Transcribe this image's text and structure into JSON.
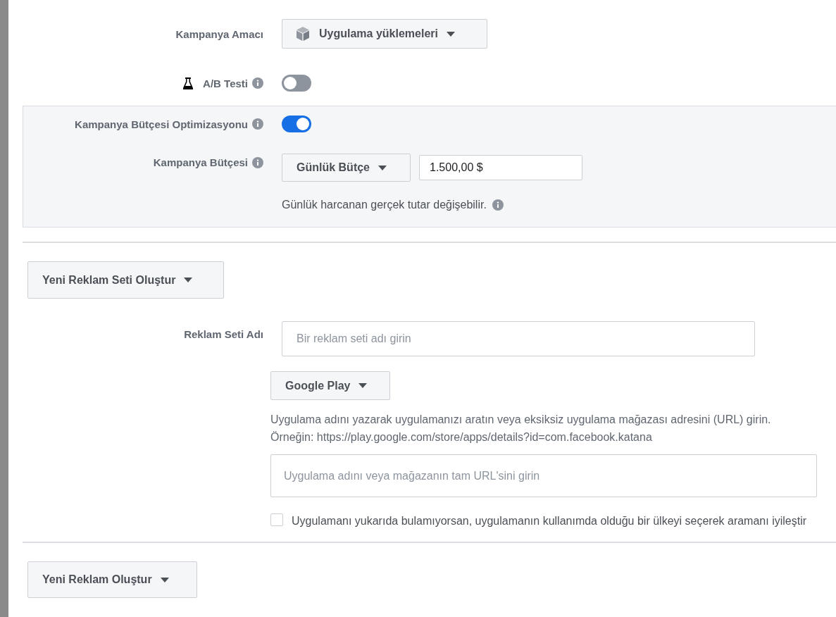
{
  "objective": {
    "label": "Kampanya Amacı",
    "value": "Uygulama yüklemeleri"
  },
  "ab_test": {
    "label": "A/B Testi",
    "on": false
  },
  "budget_panel": {
    "optimization": {
      "label": "Kampanya Bütçesi Optimizasyonu",
      "on": true
    },
    "budget": {
      "label": "Kampanya Bütçesi",
      "type": "Günlük Bütçe",
      "value": "1.500,00 $",
      "hint": "Günlük harcanan gerçek tutar değişebilir."
    }
  },
  "ad_set": {
    "create_button": "Yeni Reklam Seti Oluştur",
    "name": {
      "label": "Reklam Seti Adı",
      "placeholder": "Bir reklam seti adı girin"
    },
    "store_button": "Google Play",
    "help": [
      "Uygulama adını yazarak uygulamanızı aratın veya eksiksiz uygulama mağazası adresini (URL) girin.",
      "Örneğin: https://play.google.com/store/apps/details?id=com.facebook.katana"
    ],
    "app_search": {
      "placeholder": "Uygulama adını veya mağazanın tam URL'sini girin"
    },
    "refine": {
      "label": "Uygulamanı yukarıda bulamıyorsan, uygulamanın kullanımda olduğu bir ülkeyi seçerek aramanı iyileştir",
      "checked": false
    }
  },
  "ad": {
    "create_button": "Yeni Reklam Oluştur"
  }
}
